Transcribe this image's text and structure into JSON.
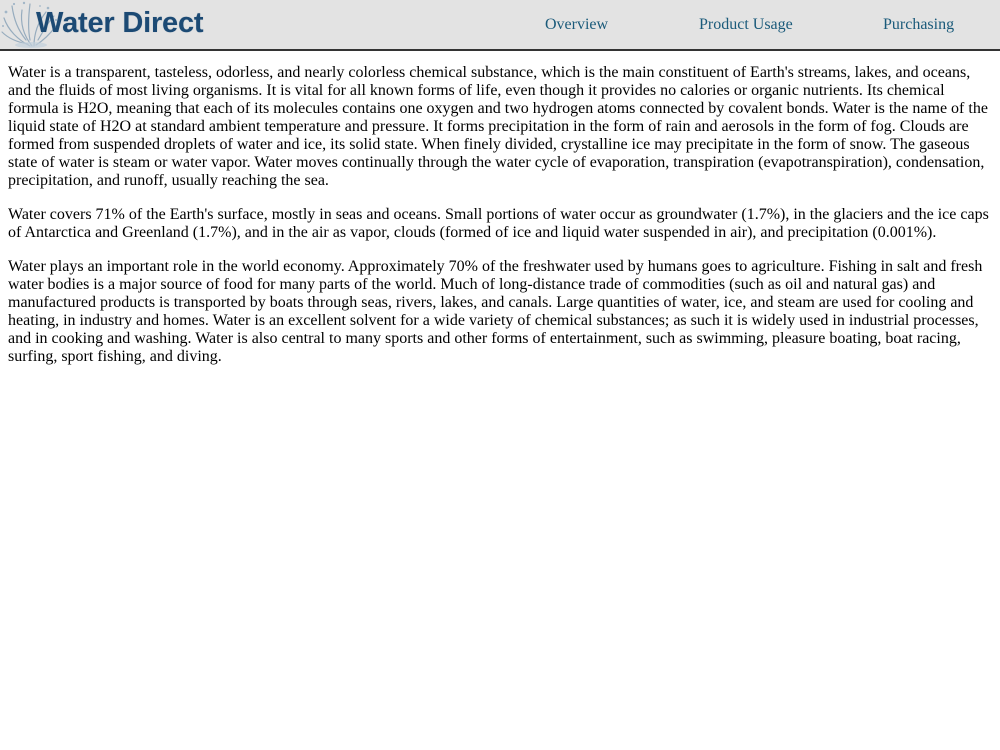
{
  "brand": {
    "name": "Water Direct",
    "logo_icon": "water-splash-icon",
    "color": "#1c4a74"
  },
  "nav": {
    "items": [
      {
        "label": "Overview"
      },
      {
        "label": "Product Usage"
      },
      {
        "label": "Purchasing"
      }
    ],
    "link_color": "#1a5a7a",
    "bar_color": "#e3e3e3"
  },
  "content": {
    "paragraphs": [
      "Water is a transparent, tasteless, odorless, and nearly colorless chemical substance, which is the main constituent of Earth's streams, lakes, and oceans, and the fluids of most living organisms. It is vital for all known forms of life, even though it provides no calories or organic nutrients. Its chemical formula is H2O, meaning that each of its molecules contains one oxygen and two hydrogen atoms connected by covalent bonds. Water is the name of the liquid state of H2O at standard ambient temperature and pressure. It forms precipitation in the form of rain and aerosols in the form of fog. Clouds are formed from suspended droplets of water and ice, its solid state. When finely divided, crystalline ice may precipitate in the form of snow. The gaseous state of water is steam or water vapor. Water moves continually through the water cycle of evaporation, transpiration (evapotranspiration), condensation, precipitation, and runoff, usually reaching the sea.",
      "Water covers 71% of the Earth's surface, mostly in seas and oceans. Small portions of water occur as groundwater (1.7%), in the glaciers and the ice caps of Antarctica and Greenland (1.7%), and in the air as vapor, clouds (formed of ice and liquid water suspended in air), and precipitation (0.001%).",
      "Water plays an important role in the world economy. Approximately 70% of the freshwater used by humans goes to agriculture. Fishing in salt and fresh water bodies is a major source of food for many parts of the world. Much of long-distance trade of commodities (such as oil and natural gas) and manufactured products is transported by boats through seas, rivers, lakes, and canals. Large quantities of water, ice, and steam are used for cooling and heating, in industry and homes. Water is an excellent solvent for a wide variety of chemical substances; as such it is widely used in industrial processes, and in cooking and washing. Water is also central to many sports and other forms of entertainment, such as swimming, pleasure boating, boat racing, surfing, sport fishing, and diving."
    ]
  }
}
